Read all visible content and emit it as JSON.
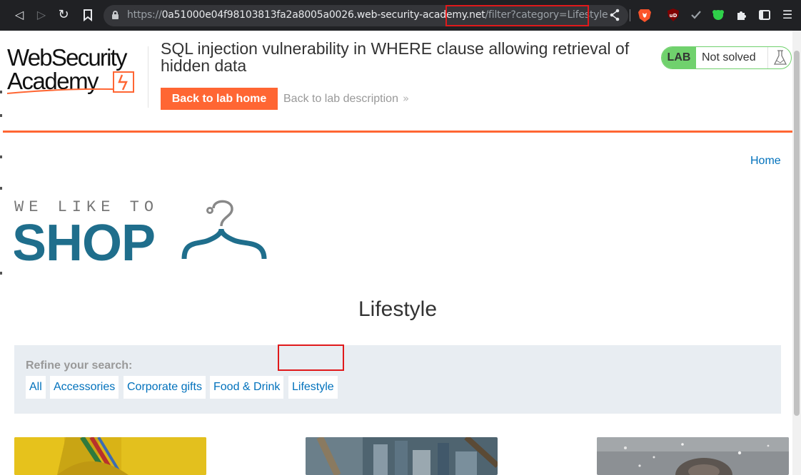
{
  "browser": {
    "url_protocol": "https://",
    "url_host": "0a51000e04f98103813fa2a8005a0026.web-security-academy.n",
    "url_host_end": "et",
    "url_path": "/filter?category=Lifestyle",
    "nav_back": "◁",
    "nav_forward": "▷",
    "nav_reload": "↻",
    "menu": "☰"
  },
  "academy": {
    "logo_line1": "WebSecurity",
    "logo_line2": "Academy",
    "lab_title": "SQL injection vulnerability in WHERE clause allowing retrieval of hidden data",
    "back_to_lab_home": "Back to lab home",
    "back_to_lab_description": "Back to lab description",
    "chevron": "»",
    "lab_badge": "LAB",
    "lab_status": "Not solved"
  },
  "shop": {
    "home_link": "Home",
    "logo_tagline": "WE LIKE TO",
    "logo_word": "SHOP",
    "category_heading": "Lifestyle",
    "refine_label": "Refine your search:",
    "filters": [
      "All",
      "Accessories",
      "Corporate gifts",
      "Food & Drink",
      "Lifestyle"
    ]
  },
  "colors": {
    "accent_orange": "#ff6633",
    "link_blue": "#0071bc",
    "lab_green": "#70d16d",
    "shop_blue": "#1f6e8c",
    "highlight_red": "#e0191b"
  }
}
